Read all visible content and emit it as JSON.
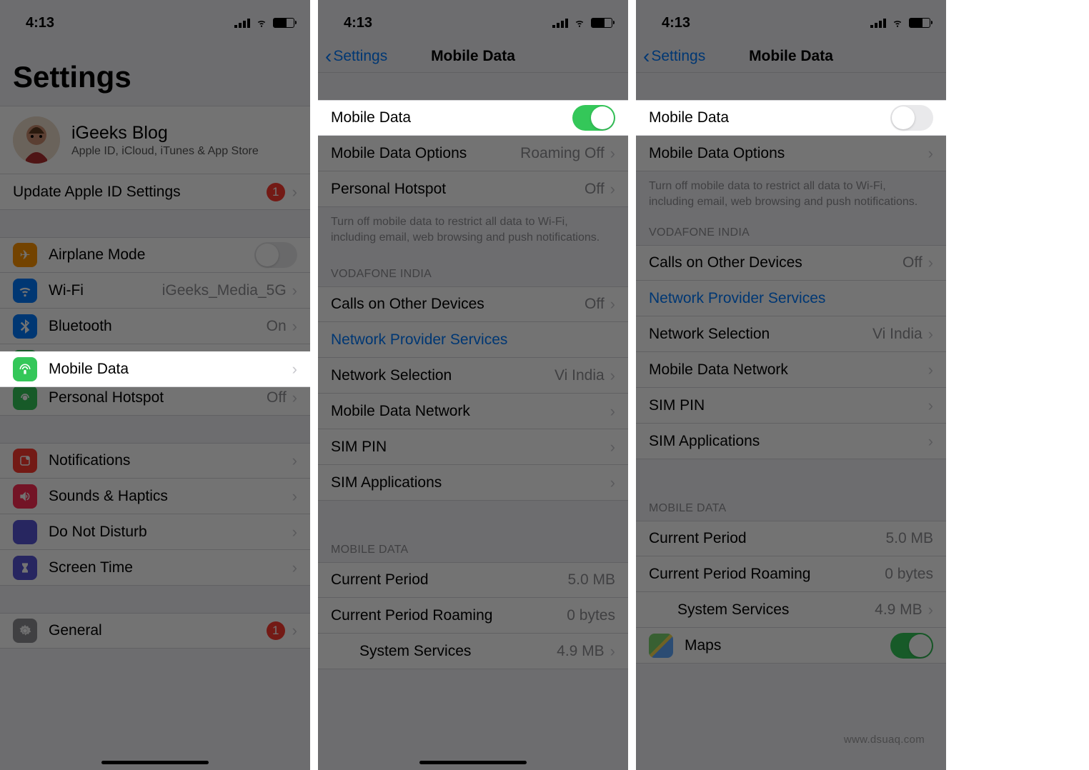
{
  "status": {
    "time": "4:13"
  },
  "nav": {
    "back": "Settings",
    "title": "Mobile Data"
  },
  "screen1": {
    "title": "Settings",
    "profile_name": "iGeeks Blog",
    "profile_sub": "Apple ID, iCloud, iTunes & App Store",
    "update": "Update Apple ID Settings",
    "badge1": "1",
    "airplane": "Airplane Mode",
    "wifi": "Wi-Fi",
    "wifi_val": "iGeeks_Media_5G",
    "bluetooth": "Bluetooth",
    "bluetooth_val": "On",
    "mobile_data": "Mobile Data",
    "hotspot": "Personal Hotspot",
    "hotspot_val": "Off",
    "notifications": "Notifications",
    "sounds": "Sounds & Haptics",
    "dnd": "Do Not Disturb",
    "screen_time": "Screen Time",
    "general": "General"
  },
  "md": {
    "mobile_data": "Mobile Data",
    "options": "Mobile Data Options",
    "options_val": "Roaming Off",
    "hotspot": "Personal Hotspot",
    "hotspot_val": "Off",
    "note": "Turn off mobile data to restrict all data to Wi-Fi, including email, web browsing and push notifications.",
    "carrier_head": "VODAFONE INDIA",
    "calls_other": "Calls on Other Devices",
    "calls_other_val": "Off",
    "provider": "Network Provider Services",
    "net_sel": "Network Selection",
    "net_sel_val": "Vi India",
    "data_network": "Mobile Data Network",
    "sim_pin": "SIM PIN",
    "sim_apps": "SIM Applications",
    "mobile_data_head": "MOBILE DATA",
    "current_period": "Current Period",
    "current_period_val": "5.0 MB",
    "roaming": "Current Period Roaming",
    "roaming_val": "0 bytes",
    "system_services": "System Services",
    "system_services_val": "4.9 MB",
    "maps": "Maps"
  },
  "watermark": "www.dsuaq.com"
}
